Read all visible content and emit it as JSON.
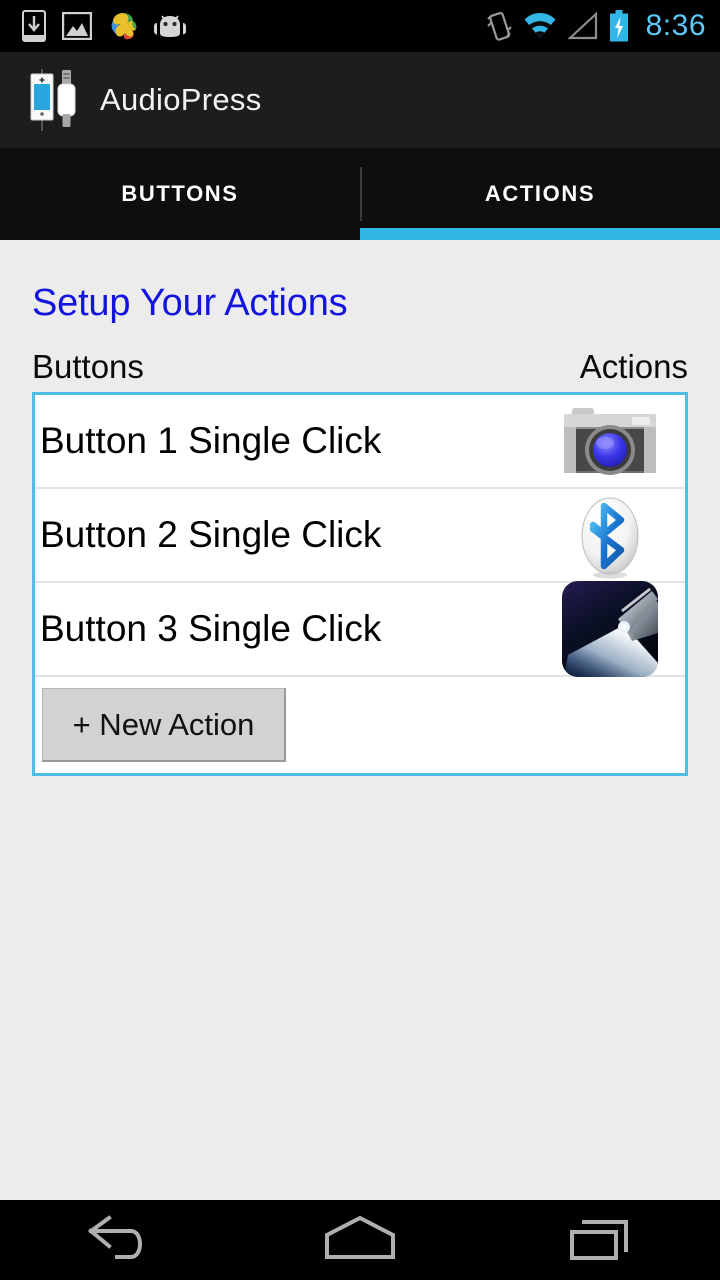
{
  "status_bar": {
    "time": "8:36",
    "time_color": "#5BC8F5",
    "left_icons": [
      {
        "name": "download-to-device-icon",
        "label": "download"
      },
      {
        "name": "screenshot-image-icon",
        "label": "screenshot"
      },
      {
        "name": "photos-swirl-icon",
        "label": "photos"
      },
      {
        "name": "android-robot-icon",
        "label": "android"
      }
    ],
    "right_icons": [
      {
        "name": "vibrate-icon",
        "label": "vibrate"
      },
      {
        "name": "wifi-icon",
        "label": "wifi"
      },
      {
        "name": "cellular-signal-icon",
        "label": "signal"
      },
      {
        "name": "battery-charging-icon",
        "label": "battery charging"
      }
    ]
  },
  "action_bar": {
    "title": "AudioPress",
    "icon_name": "audiopress-app-icon"
  },
  "tabs": [
    {
      "label": "BUTTONS",
      "selected": false
    },
    {
      "label": "ACTIONS",
      "selected": true
    }
  ],
  "accent_color": "#33B5E5",
  "main": {
    "heading": "Setup Your Actions",
    "heading_color": "#1414E0",
    "columns": {
      "left": "Buttons",
      "right": "Actions"
    },
    "rows": [
      {
        "label": "Button 1 Single Click",
        "icon": "camera-icon"
      },
      {
        "label": "Button 2 Single Click",
        "icon": "bluetooth-icon"
      },
      {
        "label": "Button 3 Single Click",
        "icon": "flashlight-icon"
      }
    ],
    "new_action_label": "+ New Action"
  },
  "nav_bar": {
    "buttons": [
      {
        "name": "back-button",
        "label": "Back"
      },
      {
        "name": "home-button",
        "label": "Home"
      },
      {
        "name": "recents-button",
        "label": "Recent apps"
      }
    ]
  }
}
